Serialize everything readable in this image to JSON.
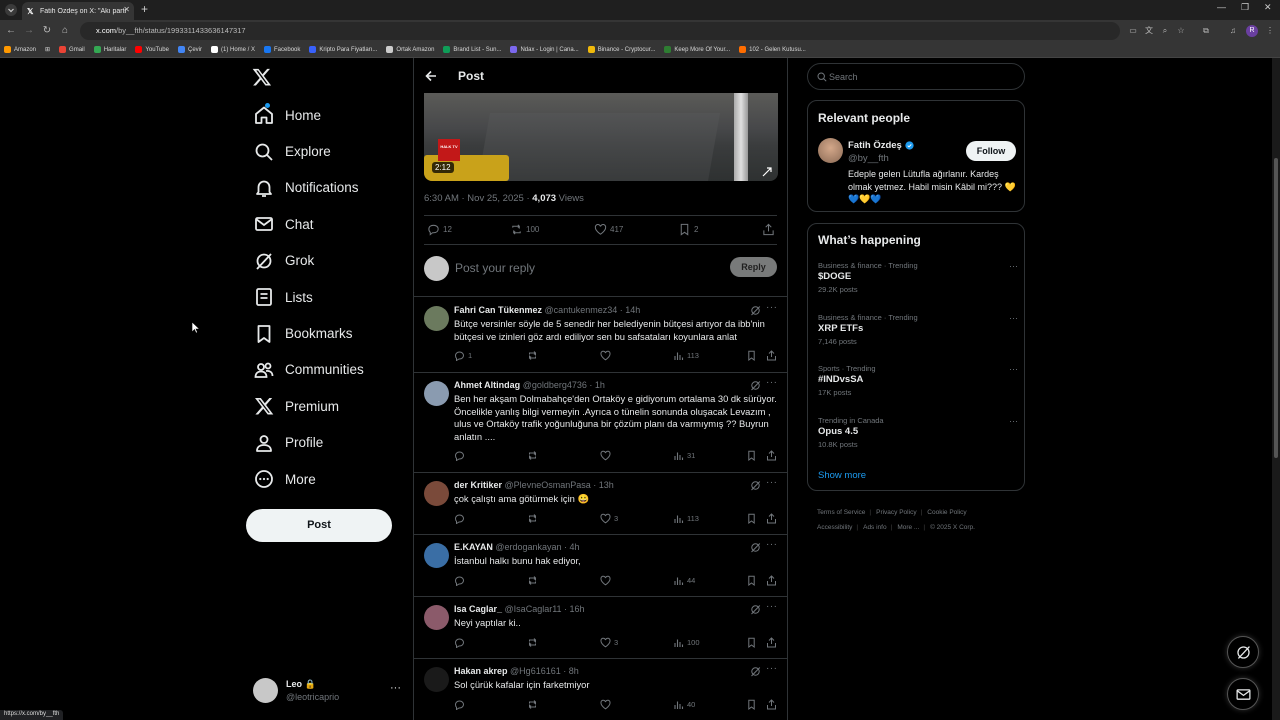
{
  "browser": {
    "tab_title": "Fatih Özdeş on X: \"Akı parti dön...",
    "url_host": "x.com",
    "url_path": "/by__fth/status/1993311433636147317",
    "status_url": "https://x.com/by__fth",
    "bookmarks": [
      {
        "label": "Amazon",
        "color": "#ff9900"
      },
      {
        "label": "Gmail",
        "color": "#ea4335"
      },
      {
        "label": "Haritalar",
        "color": "#34a853"
      },
      {
        "label": "YouTube",
        "color": "#ff0000"
      },
      {
        "label": "Çevir",
        "color": "#4285f4"
      },
      {
        "label": "(1) Home / X",
        "color": "#ffffff"
      },
      {
        "label": "Facebook",
        "color": "#1877f2"
      },
      {
        "label": "Kripto Para Fiyatları...",
        "color": "#3861fb"
      },
      {
        "label": "Ortak Amazon",
        "color": "#cccccc"
      },
      {
        "label": "Brand List - Sun...",
        "color": "#0f9d58"
      },
      {
        "label": "Ndax - Login | Cana...",
        "color": "#7b68ee"
      },
      {
        "label": "Binance - Cryptocur...",
        "color": "#f0b90b"
      },
      {
        "label": "Keep More Of Your...",
        "color": "#2e7d32"
      },
      {
        "label": "102 - Gelen Kutusu...",
        "color": "#ff6d00"
      }
    ]
  },
  "nav": {
    "items": [
      {
        "label": "Home",
        "icon": "home-icon",
        "badge": true
      },
      {
        "label": "Explore",
        "icon": "search-icon"
      },
      {
        "label": "Notifications",
        "icon": "bell-icon"
      },
      {
        "label": "Chat",
        "icon": "mail-icon"
      },
      {
        "label": "Grok",
        "icon": "grok-icon"
      },
      {
        "label": "Lists",
        "icon": "list-icon"
      },
      {
        "label": "Bookmarks",
        "icon": "bookmark-icon"
      },
      {
        "label": "Communities",
        "icon": "people-icon"
      },
      {
        "label": "Premium",
        "icon": "x-logo-icon"
      },
      {
        "label": "Profile",
        "icon": "person-icon"
      },
      {
        "label": "More",
        "icon": "more-circle-icon"
      }
    ],
    "post_label": "Post"
  },
  "account": {
    "name": "Leo",
    "handle": "@leotricaprio"
  },
  "main": {
    "title": "Post",
    "video_duration": "2:12",
    "timestamp": "6:30 AM · Nov 25, 2025 · ",
    "views_count": "4,073",
    "views_label": " Views",
    "stats": {
      "replies": "12",
      "reposts": "100",
      "likes": "417",
      "bookmarks": "2"
    },
    "reply_placeholder": "Post your reply",
    "reply_button": "Reply"
  },
  "replies": [
    {
      "name": "Fahri Can Tükenmez",
      "handle": "@cantukenmez34 · 14h",
      "text": "Bütçe versinler söyle de 5 senedir her belediyenin bütçesi artıyor da ibb'nin bütçesi ve izinleri göz ardı ediliyor sen bu safsataları koyunlara anlat",
      "replies": "1",
      "reposts": "",
      "likes": "",
      "views": "113",
      "avatar": "#6b7a5e"
    },
    {
      "name": "Ahmet Altindag",
      "handle": "@goldberg4736 · 1h",
      "text": "Ben her akşam Dolmabahçe'den Ortaköy e gidiyorum ortalama 30 dk sürüyor. Öncelikle yanlış bilgi vermeyin .Ayrıca o tünelin sonunda oluşacak Levazım , ulus ve Ortaköy trafik yoğunluğuna bir çözüm planı da varmıymış ?? Buyrun anlatın ....",
      "replies": "",
      "reposts": "",
      "likes": "",
      "views": "31",
      "avatar": "#8a9bb0"
    },
    {
      "name": "der Kritiker",
      "handle": "@PlevneOsmanPasa · 13h",
      "text": "çok çalıştı ama götürmek için 😀",
      "replies": "",
      "reposts": "",
      "likes": "3",
      "views": "113",
      "avatar": "#7a4a3a"
    },
    {
      "name": "E.KAYAN",
      "handle": "@erdogankayan · 4h",
      "text": "İstanbul halkı bunu hak ediyor,",
      "replies": "",
      "reposts": "",
      "likes": "",
      "views": "44",
      "avatar": "#3a6ea5"
    },
    {
      "name": "Isa Caglar_",
      "handle": "@IsaCaglar11 · 16h",
      "text": "Neyi yaptılar ki..",
      "replies": "",
      "reposts": "",
      "likes": "3",
      "views": "100",
      "avatar": "#8b5a6a"
    },
    {
      "name": "Hakan akrep",
      "handle": "@Hg616161 · 8h",
      "text": "Sol çürük kafalar için farketmiyor",
      "replies": "",
      "reposts": "",
      "likes": "",
      "views": "40",
      "avatar": "#1a1a1a"
    }
  ],
  "right": {
    "search_placeholder": "Search",
    "relevant_title": "Relevant people",
    "person": {
      "name": "Fatih Özdeş",
      "handle": "@by__fth",
      "follow": "Follow",
      "bio": "Edeple gelen Lütufla ağırlanır. Kardeş olmak yetmez. Habil misin Kâbil mi??? 💛💙💛💙"
    },
    "happening_title": "What’s happening",
    "trends": [
      {
        "context": "Business & finance · Trending",
        "title": "$DOGE",
        "count": "29.2K posts"
      },
      {
        "context": "Business & finance · Trending",
        "title": "XRP ETFs",
        "count": "7,146 posts"
      },
      {
        "context": "Sports · Trending",
        "title": "#INDvsSA",
        "count": "17K posts"
      },
      {
        "context": "Trending in Canada",
        "title": "Opus 4.5",
        "count": "10.8K posts"
      }
    ],
    "show_more": "Show more",
    "footer": [
      "Terms of Service",
      "Privacy Policy",
      "Cookie Policy",
      "Accessibility",
      "Ads info",
      "More ...",
      "© 2025 X Corp."
    ]
  },
  "colors": {
    "accent": "#1d9bf0",
    "background": "#000000",
    "border": "#2f3336",
    "muted": "#71767b"
  }
}
